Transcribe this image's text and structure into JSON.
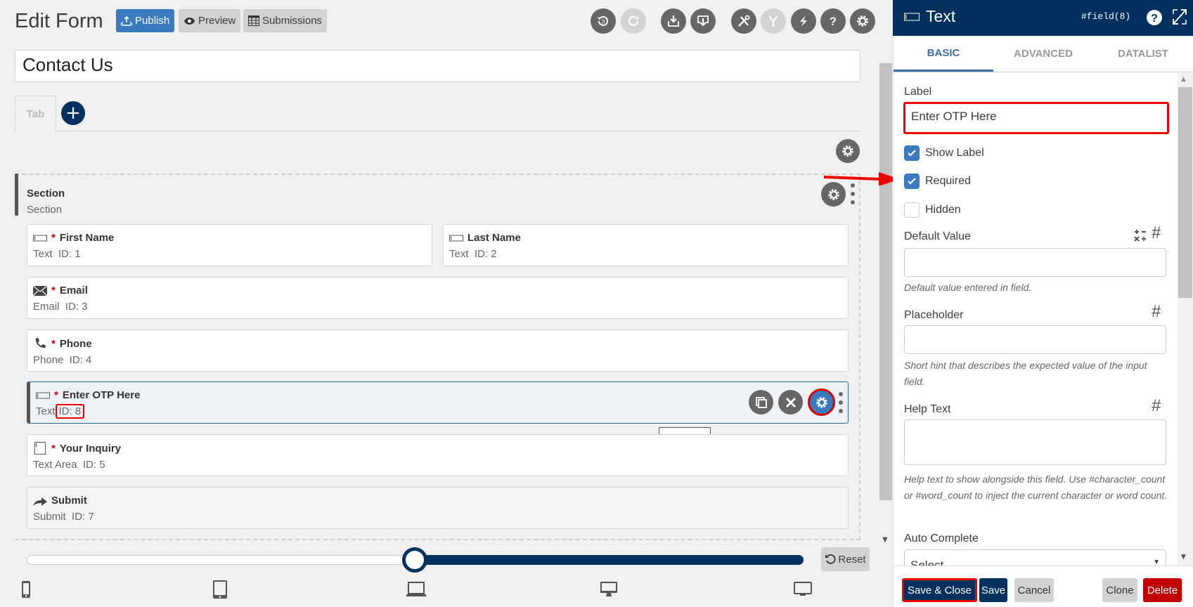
{
  "header": {
    "title": "Edit Form",
    "publish_label": "Publish",
    "preview_label": "Preview",
    "submissions_label": "Submissions",
    "undo_count": "3"
  },
  "form": {
    "name": "Contact Us",
    "tab_label": "Tab",
    "section": {
      "label": "Section",
      "sublabel": "Section"
    },
    "fields_row1": [
      {
        "label": "First Name",
        "type": "Text",
        "id": "ID: 1",
        "required": true,
        "icon": "text-field-icon"
      },
      {
        "label": "Last Name",
        "type": "Text",
        "id": "ID: 2",
        "required": false,
        "icon": "text-field-icon"
      }
    ],
    "fields": [
      {
        "label": "Email",
        "type": "Email",
        "id": "ID: 3",
        "required": true,
        "icon": "envelope-icon"
      },
      {
        "label": "Phone",
        "type": "Phone",
        "id": "ID: 4",
        "required": true,
        "icon": "phone-icon"
      },
      {
        "label": "Enter OTP Here",
        "type": "Text",
        "id": "ID: 8",
        "required": true,
        "icon": "text-field-icon",
        "selected": true
      },
      {
        "label": "Your Inquiry",
        "type": "Text Area",
        "id": "ID: 5",
        "required": true,
        "icon": "textarea-icon"
      },
      {
        "label": "Submit",
        "type": "Submit",
        "id": "ID: 7",
        "required": false,
        "icon": "share-arrow-icon"
      }
    ],
    "required_marker": "*",
    "tooltip": "#field(8)"
  },
  "breakpoint": {
    "slider_percent": 50,
    "reset_label": "Reset",
    "devices": [
      "mobile",
      "tablet",
      "laptop",
      "desktop",
      "large-desktop"
    ]
  },
  "panel": {
    "title": "Text",
    "field_ref": "#field(8)",
    "tabs": [
      {
        "label": "BASIC",
        "active": true
      },
      {
        "label": "ADVANCED",
        "active": false
      },
      {
        "label": "DATALIST",
        "active": false
      }
    ],
    "label_caption": "Label",
    "label_value": "Enter OTP Here",
    "checkboxes": [
      {
        "label": "Show Label",
        "checked": true
      },
      {
        "label": "Required",
        "checked": true
      },
      {
        "label": "Hidden",
        "checked": false
      }
    ],
    "default_value": {
      "label": "Default Value",
      "value": "",
      "hint": "Default value entered in field."
    },
    "placeholder": {
      "label": "Placeholder",
      "value": "",
      "hint": "Short hint that describes the expected value of the input field."
    },
    "help_text": {
      "label": "Help Text",
      "value": "",
      "hint": "Help text to show alongside this field. Use #character_count or #word_count to inject the current character or word count."
    },
    "auto_complete": {
      "label": "Auto Complete",
      "selected": "Select"
    },
    "hash_symbol": "#",
    "buttons": {
      "save_close": "Save & Close",
      "save": "Save",
      "cancel": "Cancel",
      "clone": "Clone",
      "delete": "Delete"
    }
  },
  "colors": {
    "brand_navy": "#00305e",
    "primary_blue": "#3a7abf",
    "danger": "#c00000",
    "annotation_red": "#ee0000"
  }
}
